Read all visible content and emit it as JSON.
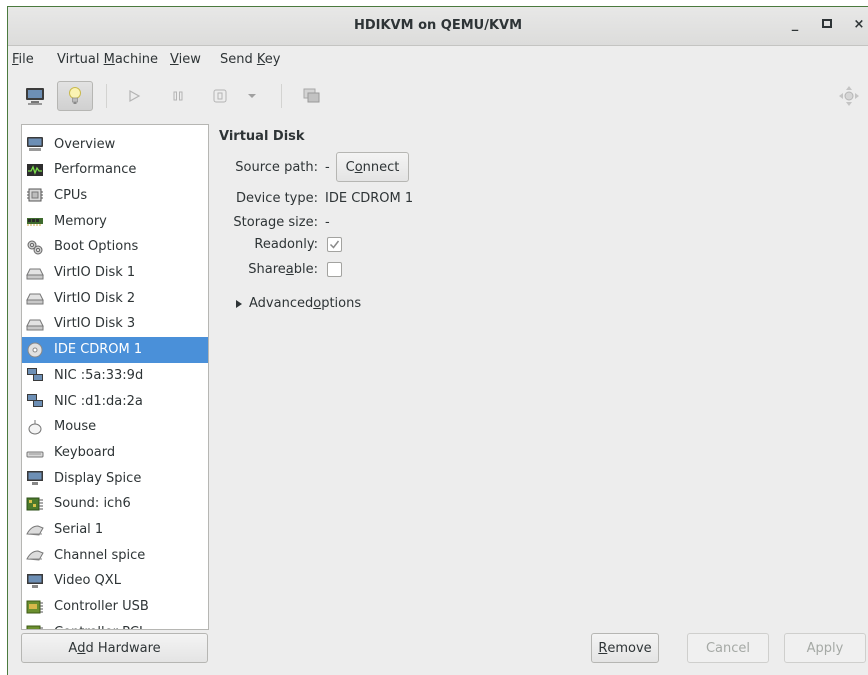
{
  "window": {
    "title": "HDIKVM on QEMU/KVM",
    "minimize": "_",
    "maximize": "▫",
    "close": "×"
  },
  "menu": {
    "file": {
      "mn": "F",
      "rest": "ile"
    },
    "vm": {
      "pre": "Virtual ",
      "mn": "M",
      "rest": "achine"
    },
    "view": {
      "mn": "V",
      "rest": "iew"
    },
    "sendkey": {
      "pre": "Send ",
      "mn": "K",
      "rest": "ey"
    }
  },
  "sidebar": {
    "items": [
      {
        "label": "Overview",
        "icon": "monitor-icon"
      },
      {
        "label": "Performance",
        "icon": "performance-icon"
      },
      {
        "label": "CPUs",
        "icon": "cpu-icon"
      },
      {
        "label": "Memory",
        "icon": "memory-icon"
      },
      {
        "label": "Boot Options",
        "icon": "gears-icon"
      },
      {
        "label": "VirtIO Disk 1",
        "icon": "disk-icon"
      },
      {
        "label": "VirtIO Disk 2",
        "icon": "disk-icon"
      },
      {
        "label": "VirtIO Disk 3",
        "icon": "disk-icon"
      },
      {
        "label": "IDE CDROM 1",
        "icon": "cdrom-icon",
        "selected": true
      },
      {
        "label": "NIC :5a:33:9d",
        "icon": "network-icon"
      },
      {
        "label": "NIC :d1:da:2a",
        "icon": "network-icon"
      },
      {
        "label": "Mouse",
        "icon": "mouse-icon"
      },
      {
        "label": "Keyboard",
        "icon": "keyboard-icon"
      },
      {
        "label": "Display Spice",
        "icon": "display-icon"
      },
      {
        "label": "Sound: ich6",
        "icon": "sound-icon"
      },
      {
        "label": "Serial 1",
        "icon": "serial-icon"
      },
      {
        "label": "Channel spice",
        "icon": "serial-icon"
      },
      {
        "label": "Video QXL",
        "icon": "display-icon"
      },
      {
        "label": "Controller USB",
        "icon": "controller-icon"
      },
      {
        "label": "Controller PCI",
        "icon": "controller-icon"
      }
    ]
  },
  "details": {
    "section_title": "Virtual Disk",
    "source_path_label": "Source path:",
    "source_path_value": "-",
    "connect": {
      "pre": "C",
      "mn": "o",
      "rest": "nnect"
    },
    "device_type_label": "Device type:",
    "device_type_value": "IDE CDROM 1",
    "storage_size_label": "Storage size:",
    "storage_size_value": "-",
    "readonly_label": "Readonly:",
    "readonly_checked": true,
    "shareable": {
      "pre": "Share",
      "mn": "a",
      "rest": "ble:"
    },
    "shareable_checked": false,
    "advanced": {
      "pre": "Advanced ",
      "mn": "o",
      "rest": "ptions"
    }
  },
  "footer": {
    "add_hardware": {
      "pre": "A",
      "mn": "d",
      "rest": "d Hardware"
    },
    "remove": {
      "mn": "R",
      "rest": "emove"
    },
    "cancel": "Cancel",
    "apply": "Apply"
  },
  "colors": {
    "selection": "#4a90d9",
    "window_bg": "#ededed",
    "text": "#2e3436",
    "disabled_text": "#a5a9a5"
  }
}
